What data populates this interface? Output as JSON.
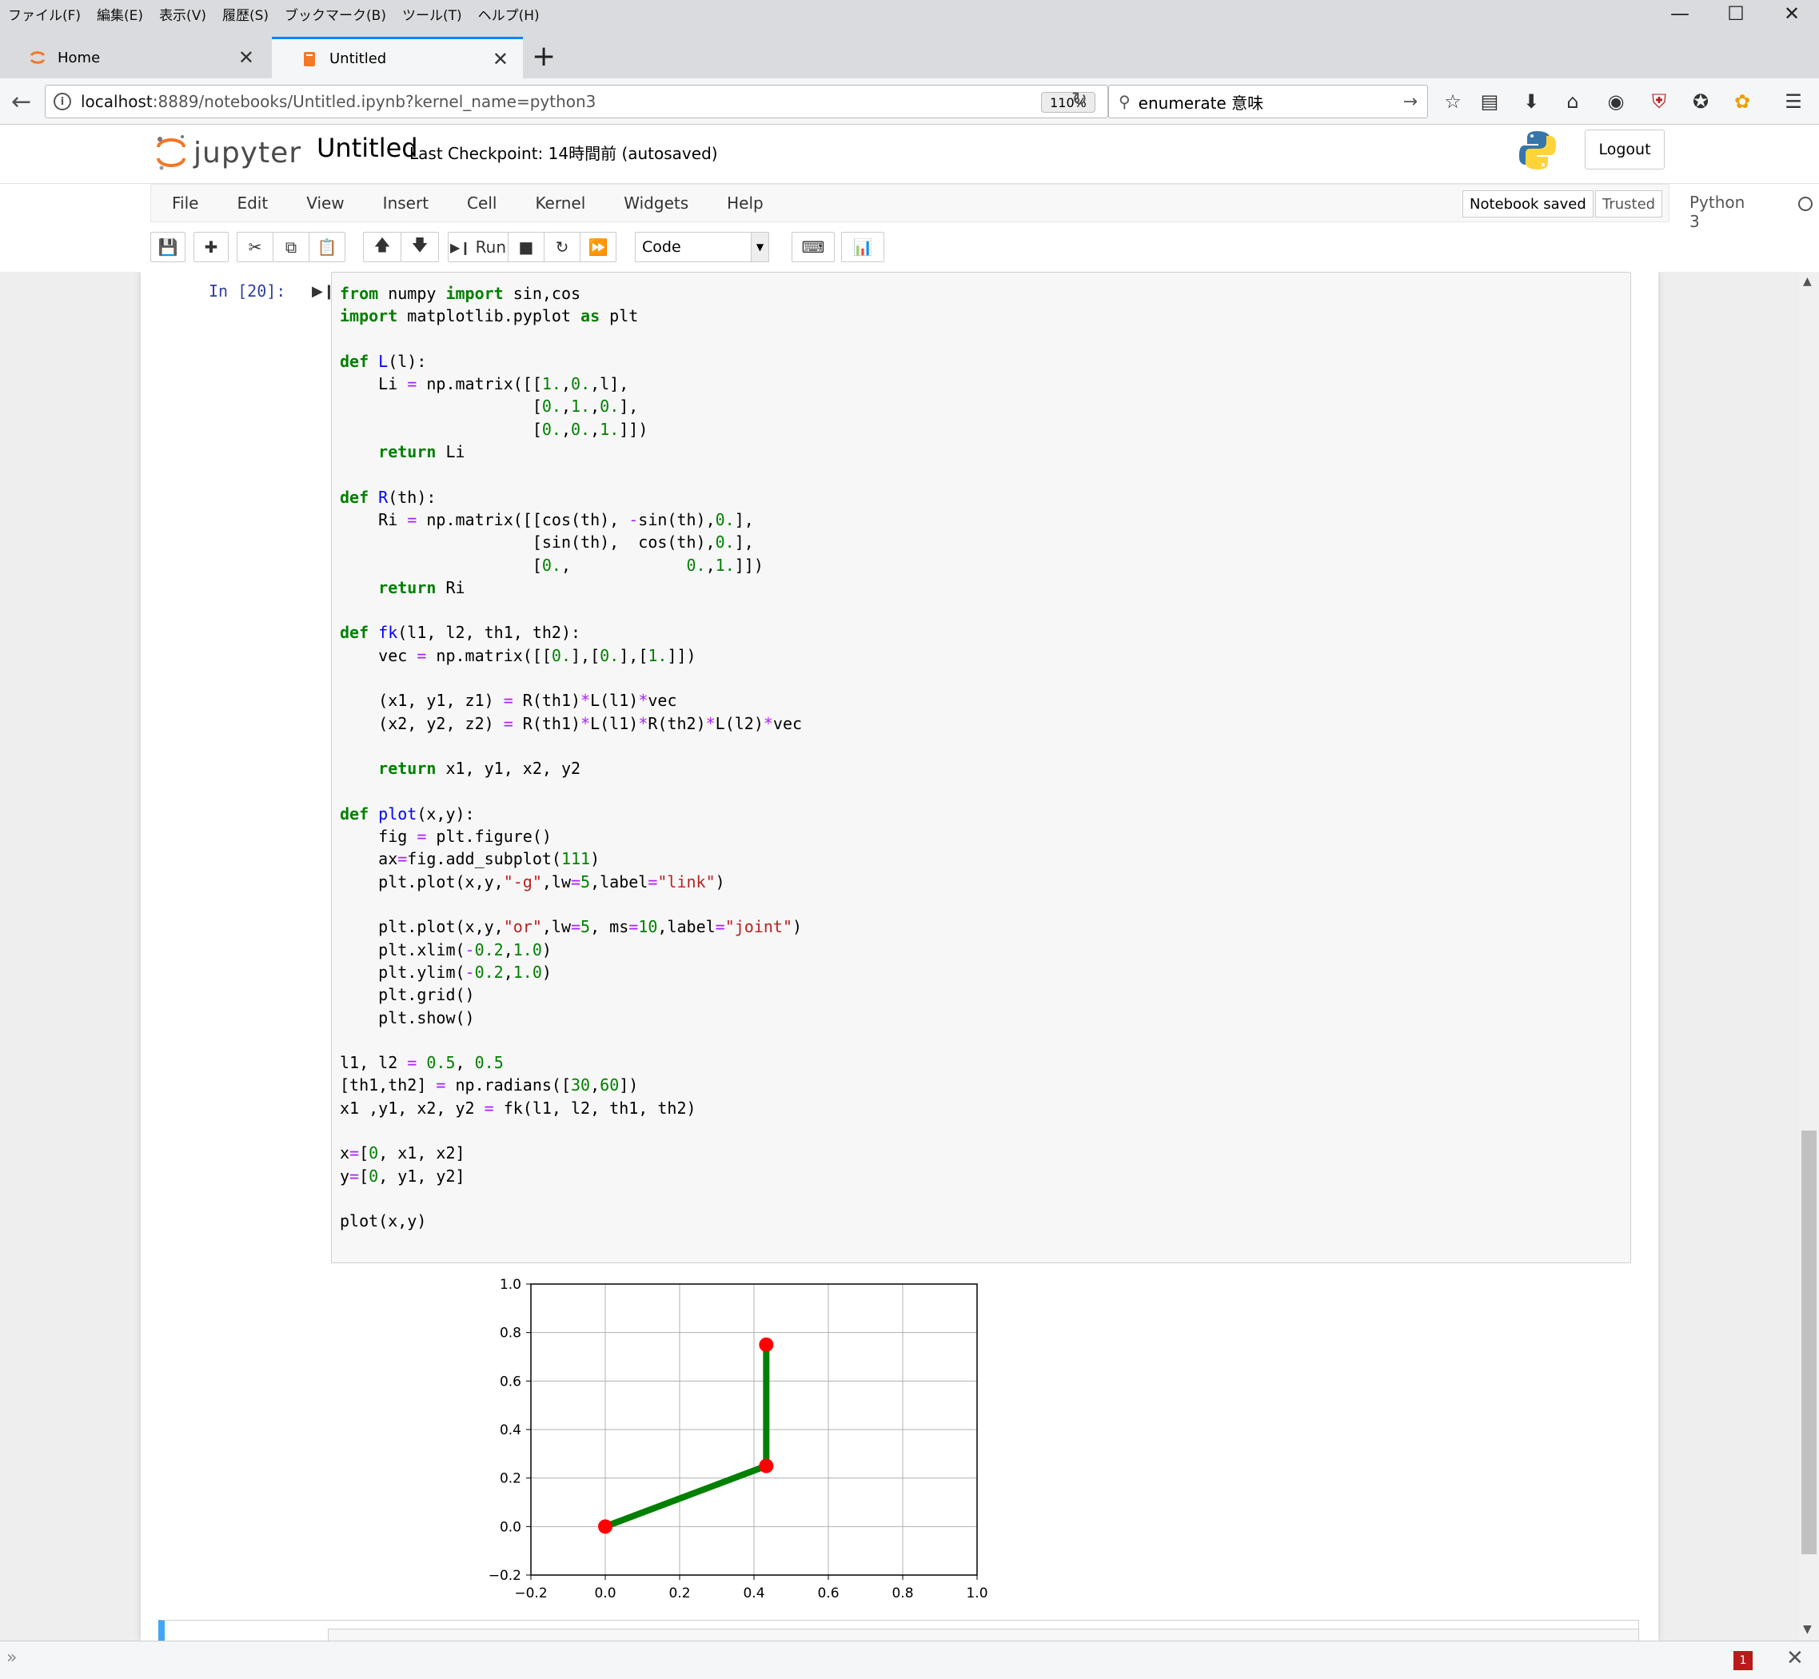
{
  "menubar": {
    "items": [
      "ファイル(F)",
      "編集(E)",
      "表示(V)",
      "履歴(S)",
      "ブックマーク(B)",
      "ツール(T)",
      "ヘルプ(H)"
    ]
  },
  "tabs": [
    {
      "label": "Home",
      "active": false
    },
    {
      "label": "Untitled",
      "active": true
    }
  ],
  "navbar": {
    "url_host": "localhost",
    "url_rest": ":8889/notebooks/Untitled.ipynb?kernel_name=python3",
    "zoom": "110%",
    "search_value": "enumerate 意味"
  },
  "jupyter": {
    "logo_text": "jupyter",
    "notebook_name": "Untitled",
    "checkpoint": "Last Checkpoint: 14時間前   (autosaved)",
    "logout": "Logout",
    "menu": [
      "File",
      "Edit",
      "View",
      "Insert",
      "Cell",
      "Kernel",
      "Widgets",
      "Help"
    ],
    "notebook_saved": "Notebook saved",
    "trusted": "Trusted",
    "kernel": "Python 3",
    "toolbar": {
      "run_label": "Run",
      "cell_type": "Code"
    }
  },
  "cell": {
    "prompt": "In [20]:"
  },
  "colors": {
    "accent": "#0a84ff",
    "link_line": "#008000",
    "joint_marker": "#ff0000",
    "prompt": "#303f9f"
  },
  "chart_data": {
    "type": "line",
    "series": [
      {
        "name": "link",
        "x": [
          0,
          0.433,
          0.433
        ],
        "y": [
          0,
          0.25,
          0.75
        ],
        "style": "-g"
      },
      {
        "name": "joint",
        "x": [
          0,
          0.433,
          0.433
        ],
        "y": [
          0,
          0.25,
          0.75
        ],
        "style": "or"
      }
    ],
    "xlim": [
      -0.2,
      1.0
    ],
    "ylim": [
      -0.2,
      1.0
    ],
    "xticks": [
      -0.2,
      0.0,
      0.2,
      0.4,
      0.6,
      0.8,
      1.0
    ],
    "yticks": [
      -0.2,
      0.0,
      0.2,
      0.4,
      0.6,
      0.8,
      1.0
    ],
    "xtick_labels": [
      "−0.2",
      "0.0",
      "0.2",
      "0.4",
      "0.6",
      "0.8",
      "1.0"
    ],
    "ytick_labels": [
      "−0.2",
      "0.0",
      "0.2",
      "0.4",
      "0.6",
      "0.8",
      "1.0"
    ],
    "grid": true,
    "title": "",
    "xlabel": "",
    "ylabel": ""
  }
}
